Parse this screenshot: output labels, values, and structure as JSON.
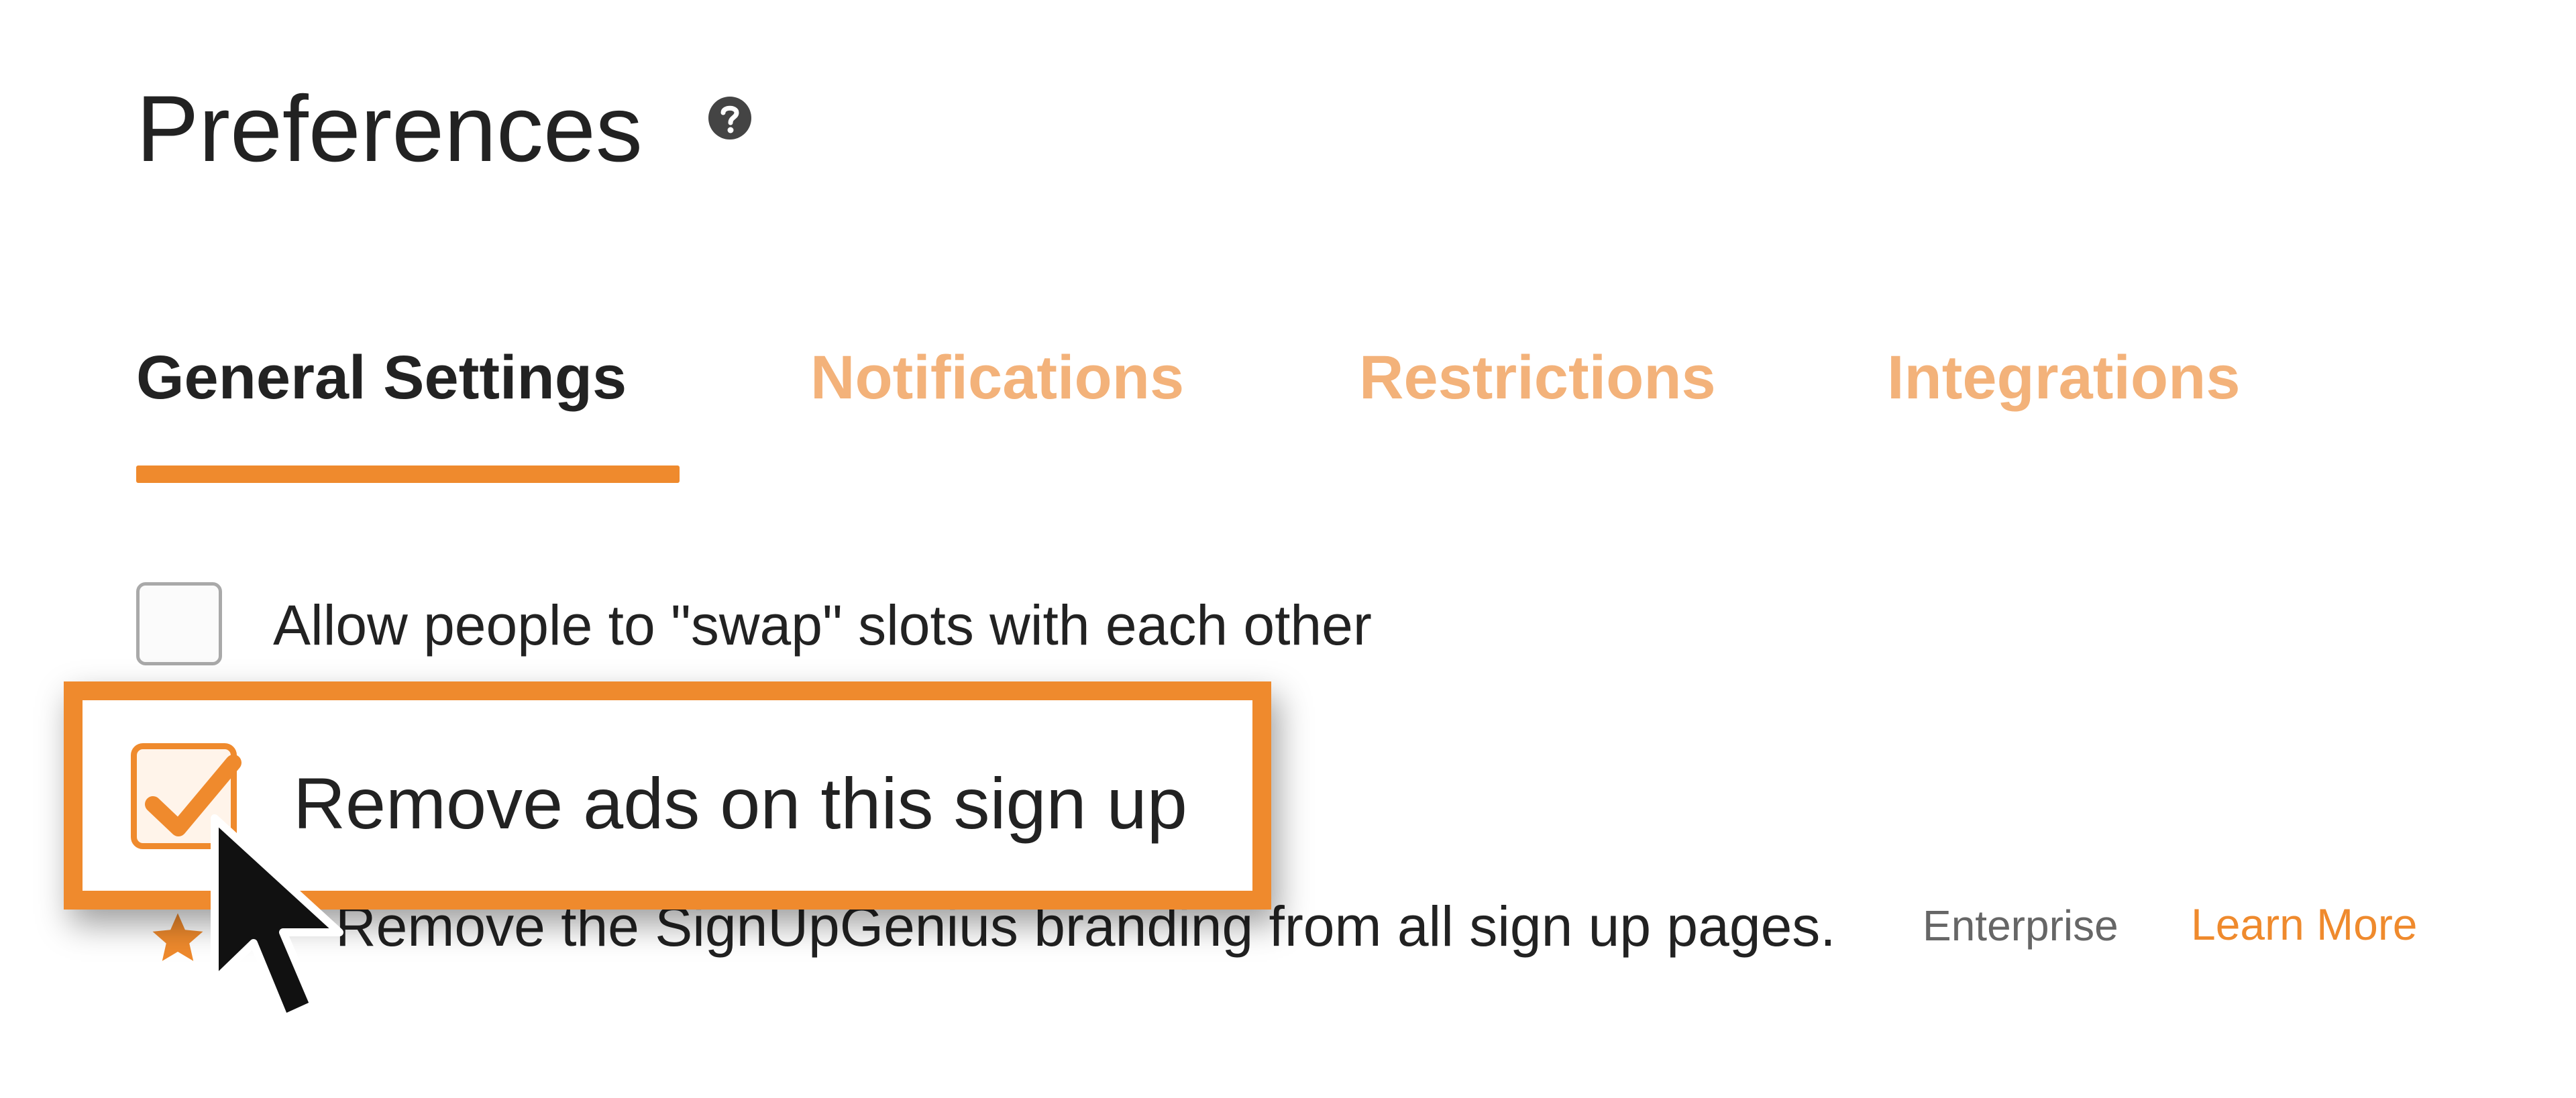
{
  "page": {
    "title": "Preferences",
    "help_icon": "question-circle-icon"
  },
  "tabs": [
    {
      "label": "General Settings",
      "active": true
    },
    {
      "label": "Notifications",
      "active": false
    },
    {
      "label": "Restrictions",
      "active": false
    },
    {
      "label": "Integrations",
      "active": false
    }
  ],
  "settings": {
    "swap_slots": {
      "label": "Allow people to \"swap\" slots with each other",
      "checked": false
    },
    "remove_ads": {
      "label": "Remove ads on this sign up",
      "checked": true
    },
    "branding": {
      "description": "Remove the SignUpGenius branding from all sign up pages.",
      "badge": "Enterprise",
      "badge_icon": "star-icon",
      "link": "Learn More"
    }
  },
  "overlay": {
    "cursor": "arrow-cursor-icon",
    "highlight_color": "#ef8a2d"
  },
  "colors": {
    "accent": "#ef8a2d",
    "inactive_tab": "#f3b27a",
    "text": "#222222",
    "muted": "#666666"
  }
}
